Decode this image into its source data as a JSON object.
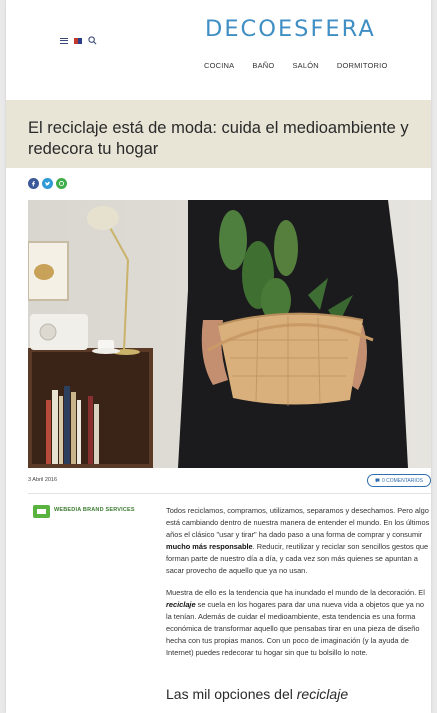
{
  "site": {
    "logo": "DECOESFERA",
    "nav": [
      "COCINA",
      "BAÑO",
      "SALÓN",
      "DORMITORIO"
    ]
  },
  "article": {
    "title": "El reciclaje está de moda: cuida el medioambiente y redecora tu hogar",
    "date": "3 Abril 2016",
    "comments_label": "0 COMENTARIOS",
    "author": "WEBEDIA BRAND SERVICES",
    "paragraph1": {
      "a": "Todos reciclamos, compramos, utilizamos, separamos y desechamos. Pero algo está cambiando dentro de nuestra manera de entender el mundo. En los últimos años el clásico \"usar y tirar\" ha dado paso a una forma de comprar y consumir ",
      "bold": "mucho más responsable",
      "b": ". Reducir, reutilizar y reciclar son sencillos gestos que forman parte de nuestro día a día, y cada vez son más quienes se apuntan a sacar provecho de aquello que ya no usan."
    },
    "paragraph2": {
      "a": "Muestra de ello es la tendencia que ha inundado el mundo de la decoración. El ",
      "bold": "reciclaje",
      "b": " se cuela en los hogares para dar una nueva vida a objetos que ya no la tenían. Además de cuidar el medioambiente, esta tendencia es una forma económica de transformar aquello que pensabas tirar en una pieza de diseño hecha con tus propias manos. Con un poco de imaginación (y la ayuda de Internet) puedes redecorar tu hogar sin que tu bolsillo lo note."
    },
    "subheading": {
      "a": "Las mil opciones del ",
      "italic": "reciclaje"
    }
  },
  "icons": {
    "menu": "menu-icon",
    "flag": "flag-icon",
    "search": "search-icon",
    "share": [
      "facebook-icon",
      "twitter-icon",
      "whatsapp-icon"
    ],
    "comment": "comment-icon"
  },
  "colors": {
    "logo": "#3f8ec4",
    "title_band": "#e8e4d6",
    "facebook": "#3b5998",
    "twitter": "#2f9ad8",
    "whatsapp": "#3fae49",
    "author": "#5ab33e"
  }
}
